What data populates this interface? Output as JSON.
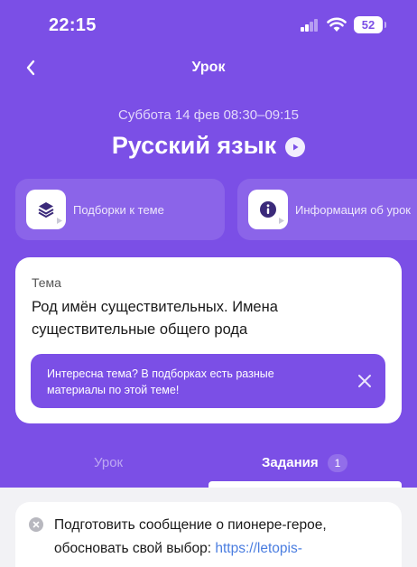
{
  "status": {
    "time": "22:15",
    "battery": "52"
  },
  "nav": {
    "title": "Урок"
  },
  "lesson": {
    "datetime": "Суббота 14 фев  08:30–09:15",
    "subject": "Русский язык"
  },
  "actions": [
    {
      "label": "Подборки к теме",
      "icon": "layers-icon"
    },
    {
      "label": "Информация об урок",
      "icon": "info-icon"
    }
  ],
  "topic": {
    "label": "Тема",
    "text": "Род имён существительных. Имена существительные общего рода",
    "hint": "Интересна тема? В подборках есть разные материалы по этой теме!"
  },
  "tabs": [
    {
      "label": "Урок",
      "active": false
    },
    {
      "label": "Задания",
      "active": true,
      "badge": "1"
    }
  ],
  "task": {
    "text": "Подготовить сообщение о пионере-герое, обосновать свой выбор: ",
    "link": "https://letopis-"
  },
  "colors": {
    "accent": "#7b4fe6",
    "link": "#4a7de0"
  }
}
